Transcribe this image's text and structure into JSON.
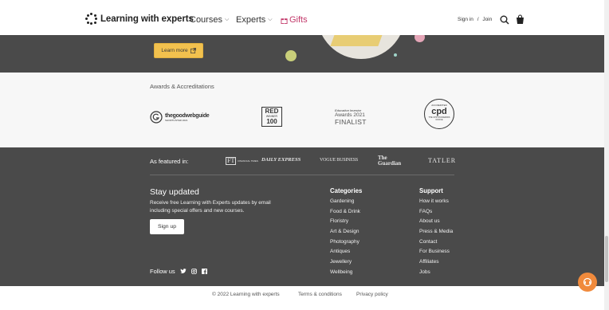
{
  "header": {
    "brand": "Learning with experts",
    "nav": {
      "courses": "Courses",
      "experts": "Experts",
      "gifts": "Gifts"
    },
    "sign_in": "Sign in",
    "separator": "/",
    "join": "Join"
  },
  "hero": {
    "learn_more": "Learn more"
  },
  "awards": {
    "title": "Awards & Accreditations",
    "items": {
      "goodwebguide": {
        "line1": "thegoodwebguide",
        "line2": "SHORTLISTED 2021"
      },
      "red": {
        "line1": "RED",
        "line2": "WINNER",
        "line3": "100"
      },
      "edinvestor": {
        "line1": "Education Investor",
        "line2": "Awards 2021",
        "line3": "FINALIST"
      },
      "cpd": {
        "top": "ACCREDITED",
        "main": "cpd",
        "bottom": "THE CPD STANDARDS OFFICE"
      }
    }
  },
  "featured": {
    "label": "As featured in:",
    "outlets": {
      "ft": "FT",
      "ft_sub": "FINANCIAL TIMES",
      "express": "DAILY EXPRESS",
      "vogue": "VOGUE BUSINESS",
      "guardian": "The Guardian",
      "tatler": "TATLER"
    }
  },
  "stay": {
    "title": "Stay updated",
    "text": "Receive free Learning with Experts updates by email including special offers and new courses.",
    "signup": "Sign up"
  },
  "follow": {
    "label": "Follow us"
  },
  "categories": {
    "title": "Categories",
    "items": [
      "Gardening",
      "Food & Drink",
      "Floristry",
      "Art & Design",
      "Photography",
      "Antiques",
      "Jewellery",
      "Wellbeing"
    ]
  },
  "support": {
    "title": "Support",
    "items": [
      "How it works",
      "FAQs",
      "About us",
      "Press & Media",
      "Contact",
      "For Business",
      "Affiliates",
      "Jobs"
    ]
  },
  "bottom": {
    "copyright": "© 2022 Learning with experts",
    "terms": "Terms & conditions",
    "privacy": "Privacy policy"
  },
  "colors": {
    "dark": "#4a4a4a",
    "accent_yellow": "#f2c14e",
    "gifts_pink": "#c2396a",
    "help_orange": "#f08a3c"
  }
}
